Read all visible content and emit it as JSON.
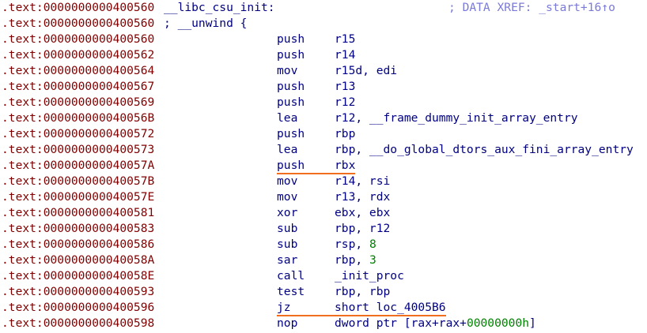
{
  "header": [
    {
      "addr": ".text:0000000000400560",
      "label": "__libc_csu_init:",
      "comment": "; DATA XREF: _start+16↑o"
    },
    {
      "addr": ".text:0000000000400560",
      "label": "; __unwind {",
      "comment": ""
    }
  ],
  "instructions": [
    {
      "addr": ".text:0000000000400560",
      "mnemonic": "push",
      "operands": [
        {
          "text": "r15",
          "kind": "reg"
        }
      ]
    },
    {
      "addr": ".text:0000000000400562",
      "mnemonic": "push",
      "operands": [
        {
          "text": "r14",
          "kind": "reg"
        }
      ]
    },
    {
      "addr": ".text:0000000000400564",
      "mnemonic": "mov",
      "operands": [
        {
          "text": "r15d, edi",
          "kind": "reg"
        }
      ]
    },
    {
      "addr": ".text:0000000000400567",
      "mnemonic": "push",
      "operands": [
        {
          "text": "r13",
          "kind": "reg"
        }
      ]
    },
    {
      "addr": ".text:0000000000400569",
      "mnemonic": "push",
      "operands": [
        {
          "text": "r12",
          "kind": "reg"
        }
      ]
    },
    {
      "addr": ".text:000000000040056B",
      "mnemonic": "lea",
      "operands": [
        {
          "text": "r12, __frame_dummy_init_array_entry",
          "kind": "sym"
        }
      ]
    },
    {
      "addr": ".text:0000000000400572",
      "mnemonic": "push",
      "operands": [
        {
          "text": "rbp",
          "kind": "reg"
        }
      ]
    },
    {
      "addr": ".text:0000000000400573",
      "mnemonic": "lea",
      "operands": [
        {
          "text": "rbp, __do_global_dtors_aux_fini_array_entry",
          "kind": "sym"
        }
      ]
    },
    {
      "addr": ".text:000000000040057A",
      "mnemonic": "push",
      "operands": [
        {
          "text": "rbx",
          "kind": "reg"
        }
      ],
      "underlined": true
    },
    {
      "addr": ".text:000000000040057B",
      "mnemonic": "mov",
      "operands": [
        {
          "text": "r14, rsi",
          "kind": "reg"
        }
      ]
    },
    {
      "addr": ".text:000000000040057E",
      "mnemonic": "mov",
      "operands": [
        {
          "text": "r13, rdx",
          "kind": "reg"
        }
      ]
    },
    {
      "addr": ".text:0000000000400581",
      "mnemonic": "xor",
      "operands": [
        {
          "text": "ebx, ebx",
          "kind": "reg"
        }
      ]
    },
    {
      "addr": ".text:0000000000400583",
      "mnemonic": "sub",
      "operands": [
        {
          "text": "rbp, r12",
          "kind": "reg"
        }
      ]
    },
    {
      "addr": ".text:0000000000400586",
      "mnemonic": "sub",
      "operands": [
        {
          "text": "rsp, ",
          "kind": "reg"
        },
        {
          "text": "8",
          "kind": "num"
        }
      ]
    },
    {
      "addr": ".text:000000000040058A",
      "mnemonic": "sar",
      "operands": [
        {
          "text": "rbp, ",
          "kind": "reg"
        },
        {
          "text": "3",
          "kind": "num"
        }
      ]
    },
    {
      "addr": ".text:000000000040058E",
      "mnemonic": "call",
      "operands": [
        {
          "text": "_init_proc",
          "kind": "sym"
        }
      ]
    },
    {
      "addr": ".text:0000000000400593",
      "mnemonic": "test",
      "operands": [
        {
          "text": "rbp, rbp",
          "kind": "reg"
        }
      ]
    },
    {
      "addr": ".text:0000000000400596",
      "mnemonic": "jz",
      "operands": [
        {
          "text": "short loc_4005B6",
          "kind": "sym"
        }
      ],
      "underlined": true
    },
    {
      "addr": ".text:0000000000400598",
      "mnemonic": "nop",
      "operands": [
        {
          "text": "dword ptr [rax+rax+",
          "kind": "reg"
        },
        {
          "text": "00000000h",
          "kind": "num"
        },
        {
          "text": "]",
          "kind": "reg"
        }
      ]
    }
  ],
  "colors": {
    "address": "#800000",
    "code": "#000080",
    "number": "#008000",
    "comment": "#7a7ad8",
    "highlight_underline": "#f06e1e"
  }
}
